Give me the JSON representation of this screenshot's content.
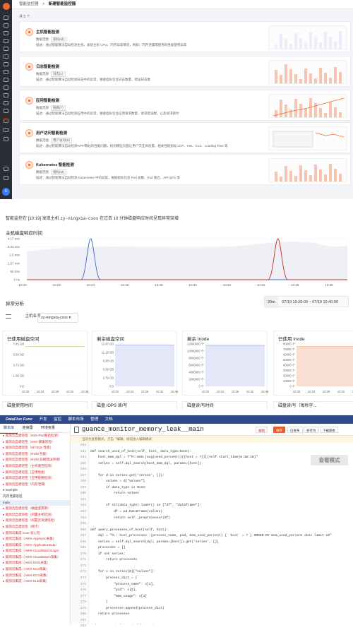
{
  "monitor_page": {
    "breadcrumb_parent": "智能监控器",
    "breadcrumb_sep": ">",
    "breadcrumb_current": "新建智能监控器",
    "count_text": "共 5 个",
    "range_label": "数据范围",
    "desc_label": "描述",
    "cards": [
      {
        "title": "主机智能检测",
        "tag": "指标(M)",
        "desc": "通过智能算法自动检测主机，发现主机 CPU、内存异常情况，例如：内存泄漏或使用的性能使用异常"
      },
      {
        "title": "日志智能检测",
        "tag": "日志(L)",
        "desc": "通过智能算法自动检测日志中的异常，根据指标包含日志数量，错误日志数"
      },
      {
        "title": "应用智能检测",
        "tag": "链路(T)",
        "desc": "通过智能算法自动检测应用中的异常，根据指标包含应用请求数量，请求错误数，以及请求耗时"
      },
      {
        "title": "用户访问智能检测",
        "tag": "用户访问(R)",
        "desc": "通过智能算法自动检测APP/网站的性能问题，找到哪些页面让用户交互体验慢，相关性能指标 LCP、FID、CLS、Loading Time 等"
      },
      {
        "title": "Kubernetes 智能检测",
        "tag": "指标(M)",
        "desc": "通过智能算法自动检测 Kubernetes 中的异常，根据指标包含 Pod 总数、Pod 重启、API QPS 等"
      }
    ]
  },
  "alert": {
    "prefix": "智能监控在 [10:19] 发现主机",
    "host": "zy-ningxia-csos",
    "suffix": "在过去 10 分钟磁盘响应时间呈现异常突增",
    "chart_title": "主机磁盘响应时间",
    "anomaly_title": "异常分析",
    "filter_label": "主机名称",
    "filter_value": "zy-ningxia-csos",
    "time_badge": "20m",
    "time_range": "07/19 10:20:00 ~ 07/19 10:40:00",
    "panels": [
      {
        "title": "已使用磁盘空间",
        "unit": "7.45 GB"
      },
      {
        "title": "剩余磁盘空间",
        "unit": "13.97 GB"
      },
      {
        "title": "剩余 Inode",
        "unit": "12000000 个"
      },
      {
        "title": "已使用 Inode",
        "unit": "80000 个"
      }
    ],
    "bottom_panels": [
      "磁盘使用时间",
      "磁盘 IOPS 读/写",
      "磁盘读/写时间",
      "磁盘读/写（每秒字..."
    ]
  },
  "chart_data": [
    {
      "type": "line",
      "title": "主机磁盘响应时间",
      "x": [
        "10:20",
        "10:22",
        "10:24",
        "10:26",
        "10:28",
        "10:30",
        "10:32",
        "10:34",
        "10:36",
        "10:38"
      ],
      "yticks": [
        "0 ns",
        "50 min",
        "1.67 min",
        "2.5 min",
        "3.33 min",
        "4.17 min"
      ],
      "series": [
        {
          "color": "#3b63d6",
          "peak_x": "10:24",
          "peak": "4.17 min"
        },
        {
          "color": "#c62828",
          "peak_x": "10:35",
          "peak": "4.17 min"
        }
      ]
    },
    {
      "type": "line",
      "title": "已使用磁盘空间",
      "x": [
        "10:20",
        "10:24",
        "10:28",
        "10:32",
        "10:36"
      ],
      "yticks": [
        "0 B",
        "1.86 GB",
        "3.73 GB",
        "5.59 GB",
        "7.45 GB"
      ],
      "values": [
        7.0,
        7.0,
        7.0,
        7.0,
        7.0,
        7.0
      ]
    },
    {
      "type": "area",
      "title": "剩余磁盘空间",
      "x": [
        "10:20",
        "10:24",
        "10:28",
        "10:32",
        "10:36"
      ],
      "yticks": [
        "0 B",
        "2.79 GB",
        "5.59 GB",
        "8.38 GB",
        "11.18 GB",
        "13.97 GB"
      ],
      "values": [
        13.6,
        13.6,
        13.6,
        13.6,
        13.6,
        13.6
      ]
    },
    {
      "type": "area",
      "title": "剩余 Inode",
      "x": [
        "10:20",
        "10:24",
        "10:28",
        "10:32",
        "10:36"
      ],
      "yticks": [
        "0 个",
        "2000000 个",
        "4000000 个",
        "6000000 个",
        "8000000 个",
        "10000000 个",
        "12000000 个"
      ],
      "values": [
        11600000,
        11600000,
        11600000,
        11600000,
        11600000,
        11600000
      ]
    },
    {
      "type": "area",
      "title": "已使用 Inode",
      "x": [
        "10:20",
        "10:24",
        "10:28",
        "10:32",
        "10:36"
      ],
      "yticks": [
        "0 个",
        "10000 个",
        "20000 个",
        "30000 个",
        "40000 个",
        "50000 个",
        "60000 个",
        "70000 个",
        "80000 个"
      ],
      "values": [
        75000,
        75000,
        75000,
        75000,
        75000,
        75000
      ]
    }
  ],
  "ide": {
    "menu": [
      "DataFlux Func",
      "开发",
      "监控",
      "脚本市场",
      "管理",
      "文档"
    ],
    "side_tabs": [
      "脚本库",
      "连接器",
      "环境变量"
    ],
    "tree": [
      {
        "t": "▸ 观测云自建巡检（K8S-Pod重启检测）",
        "c": "red"
      },
      {
        "t": "▸ 观测云自建巡检（K8S-健康巡检）",
        "c": "red"
      },
      {
        "t": "▸ 观测云自建巡检（MYSQL 性能）",
        "c": "red"
      },
      {
        "t": "▸ 观测云自建巡检（RUM 性能）",
        "c": "red"
      },
      {
        "t": "▸ 观测云自建巡检（RUM 前端错误突增）",
        "c": "red"
      },
      {
        "t": "▸ 观测云自建巡检（主机重启检测）",
        "c": "red"
      },
      {
        "t": "▸ 观测云自建巡检（应用性能）",
        "c": "red"
      },
      {
        "t": "▸ 观测云自建巡检（应用链路检测）",
        "c": "red"
      },
      {
        "t": "▸ 观测云自建巡检（内存泄漏）",
        "c": "red"
      },
      {
        "t": "▾ example",
        "c": ""
      },
      {
        "t": "   内存泄漏巡检",
        "c": ""
      },
      {
        "t": "   main",
        "c": "sel"
      },
      {
        "t": "▸ 观测云自建巡检（磁盘使用率）",
        "c": "red"
      },
      {
        "t": "▸ 观测云自建巡检（闲置主机检测）",
        "c": "red"
      },
      {
        "t": "▸ 观测云自建巡检（闲置云资源巡检）",
        "c": "red"
      },
      {
        "t": "▸ 观测云自建巡检（网卡）",
        "c": "red"
      },
      {
        "t": "▸ 观测云集成 Core 核心包",
        "c": "red"
      },
      {
        "t": "▸ 观测云集成（AWS-AppSync采集）",
        "c": "red"
      },
      {
        "t": "▸ 观测云集成（AWS-ApplicationELB）",
        "c": "red"
      },
      {
        "t": "▸ 观测云集成（AWS-CloudWatchLogs）",
        "c": "red"
      },
      {
        "t": "▸ 观测云集成（AWS-CloudWatch采集）",
        "c": "red"
      },
      {
        "t": "▸ 观测云集成（AWS-DMS采集）",
        "c": "red"
      },
      {
        "t": "▸ 观测云集成（AWS-EC2采集）",
        "c": "red"
      },
      {
        "t": "▸ 观测云集成（AWS-ECS采集）",
        "c": "red"
      },
      {
        "t": "▸ 观测云集成（AWS-ELB采集）",
        "c": "red"
      }
    ],
    "file_name": "guance_monitor_memory_leak__main",
    "buttons": [
      "编辑",
      "保存",
      "已发布",
      "另存为",
      "下载脚本"
    ],
    "hint": "当前为查看模式，点击「编辑」按钮进入编辑模式",
    "view_mode": "查看模式",
    "line_start": 252,
    "lines": [
      "",
      "def search_used_of_host(self, host, data_type=None):",
      "    host_mem_dql = f\"M::mem:(avg(used_percent)){{host = ?}}[{self.start_time}m:1m:1m]\"",
      "    series = self.dql_search(host_mem_dql, params=[host])",
      "",
      "    for d in series.get('series', []):",
      "        values = d[\"values\"]",
      "        if data_type is None:",
      "            return values",
      "",
      "        if str(data_type).lower() in [\"df\", \"dataframe\"]:",
      "            df = pd.DataFrame(values)",
      "            return self._preprocessor(df)",
      "",
      "def query_processes_of_host(self, host):",
      "    dql = \"O::`host_processes`:(process_name, pid, mem_used_percent) { `host` = ? } ORDER BY mem_used_percent desc limit 10\"",
      "    series = self.dql_search(dql, params=[host]).get('series', [])",
      "    processes = []",
      "    if not series:",
      "        return processes",
      "",
      "    for x in series[0][\"values\"]:",
      "        process_dict = {",
      "            \"process_name\": x[1],",
      "            \"pid\": x[2],",
      "            \"mem_usage\": x[3]",
      "        }",
      "        processes.append(process_dict)",
      "    return processes",
      "",
      "def query_pod_of_host(self, host):"
    ]
  }
}
